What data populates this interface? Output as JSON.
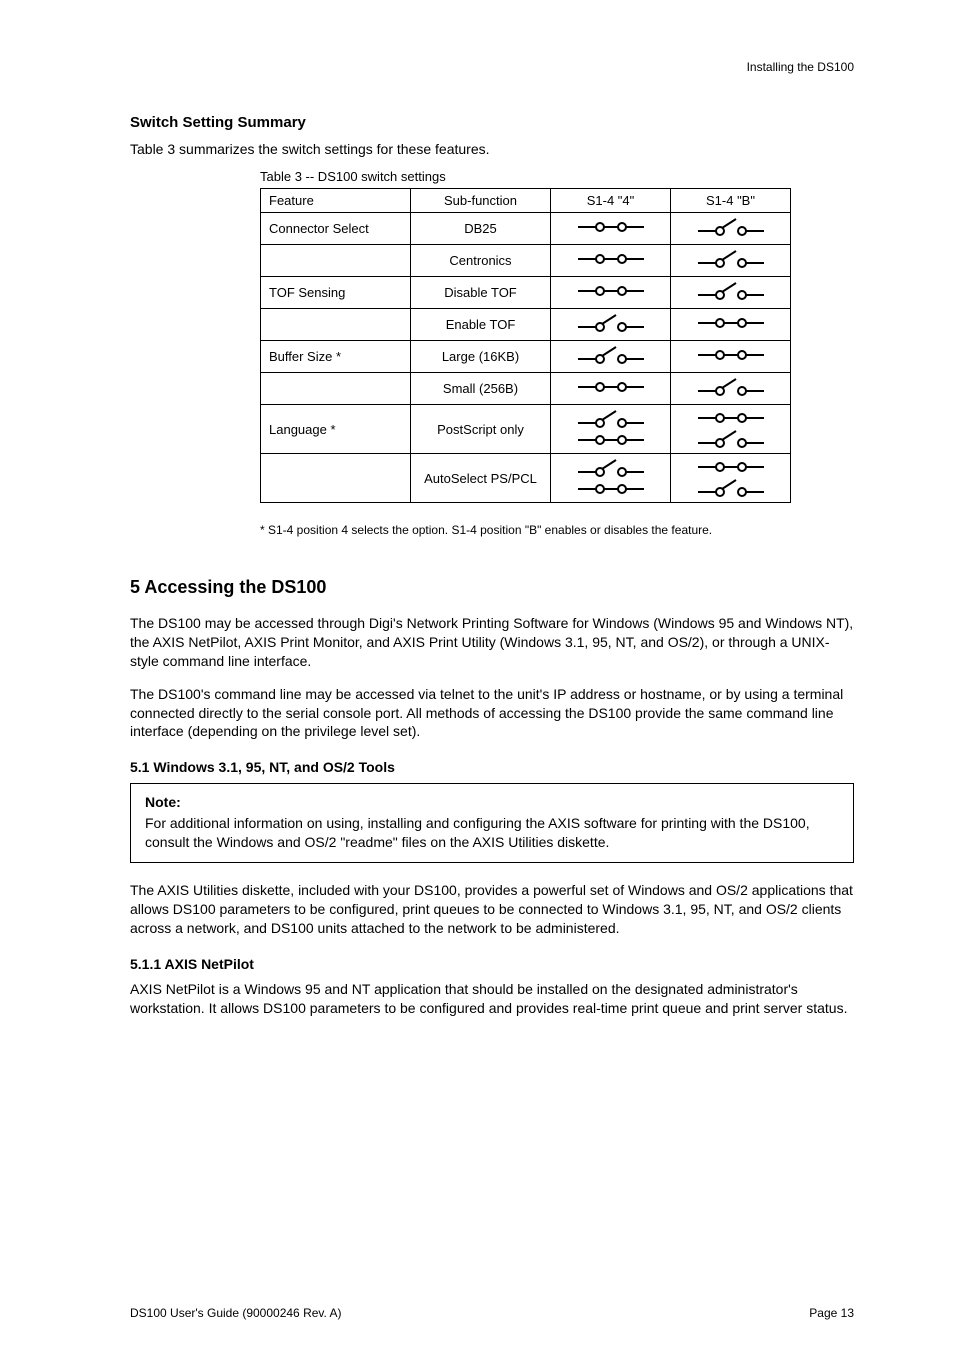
{
  "header_right": "Installing the DS100",
  "section4": {
    "title": "Switch Setting Summary",
    "desc": "Table 3 summarizes the switch settings for these features.",
    "table_caption": "Table 3 -- DS100 switch settings",
    "headers": [
      "Feature",
      "Sub-function",
      "S1-4 \"4\"",
      "S1-4 \"B\""
    ],
    "rows": [
      {
        "feature": "Connector Select",
        "sub": "DB25",
        "s4": "closed",
        "sB": "open"
      },
      {
        "feature": "",
        "sub": "Centronics",
        "s4": "closed",
        "sB": "open"
      },
      {
        "feature": "TOF Sensing",
        "sub": "Disable TOF",
        "s4": "closed",
        "sB": "open"
      },
      {
        "feature": "",
        "sub": "Enable TOF",
        "s4": "open",
        "sB": "closed"
      },
      {
        "feature": "Buffer Size *",
        "sub": "Large (16KB)",
        "s4": "open",
        "sB": "closed"
      },
      {
        "feature": "",
        "sub": "Small (256B)",
        "s4": "closed",
        "sB": "open"
      },
      {
        "feature": "Language *",
        "sub": "PostScript only",
        "s4_pair": [
          "open",
          "closed"
        ],
        "sB_pair": [
          "closed",
          "open"
        ]
      },
      {
        "feature": "",
        "sub": "AutoSelect PS/PCL",
        "s4_pair": [
          "open",
          "closed"
        ],
        "sB_pair": [
          "closed",
          "open"
        ]
      }
    ],
    "note": "* S1-4 position 4 selects the option. S1-4 position \"B\" enables or disables the feature."
  },
  "section5": {
    "heading": "5 Accessing the DS100",
    "p1": "The DS100 may be accessed through Digi's Network Printing Software for Windows (Windows 95 and Windows NT), the AXIS NetPilot, AXIS Print Monitor, and AXIS Print Utility (Windows 3.1, 95, NT, and OS/2), or through a UNIX-style command line interface.",
    "p2": "The DS100's command line may be accessed via telnet to the unit's IP address or hostname, or by using a terminal connected directly to the serial console port. All methods of accessing the DS100 provide the same command line interface (depending on the privilege level set)."
  },
  "sub_section": {
    "title": "5.1 Windows 3.1, 95, NT, and OS/2 Tools",
    "note_label": "Note:",
    "note_text": "For additional information on using, installing and configuring the AXIS software for printing with the DS100, consult the Windows and OS/2 \"readme\" files on the AXIS Utilities diskette.",
    "p1": "The AXIS Utilities diskette, included with your DS100, provides a powerful set of Windows and OS/2 applications that allows DS100 parameters to be configured, print queues to be connected to Windows 3.1, 95, NT, and OS/2 clients across a network, and DS100 units attached to the network to be administered."
  },
  "sub_sub": {
    "title": "5.1.1 AXIS NetPilot",
    "p1": "AXIS NetPilot is a Windows 95 and NT application that should be installed on the designated administrator's workstation. It allows DS100 parameters to be configured and provides real-time print queue and print server status."
  },
  "footer_left": "DS100 User's Guide (90000246 Rev. A)",
  "footer_right": "Page 13"
}
